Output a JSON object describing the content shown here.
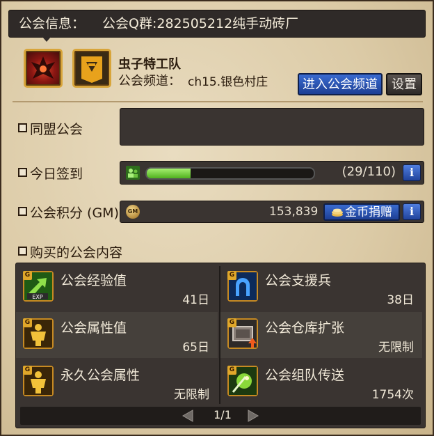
{
  "header": {
    "title": "公会信息：",
    "qq_group": "公会Q群:282505212纯手动砖厂"
  },
  "guild": {
    "name": "虫子特工队",
    "channel_label": "公会频道：",
    "channel_value": "ch15.银色村庄",
    "enter_channel_label": "进入公会频道",
    "settings_label": "设置"
  },
  "rows": {
    "alliance_label": "同盟公会",
    "checkin_label": "今日签到",
    "checkin_count": "(29/110)",
    "checkin_progress": 0.264,
    "points_label": "公会积分 (GM)",
    "points_value": "153,839",
    "donate_label": "金币捐赠",
    "info_label": "i"
  },
  "purchased": {
    "section_label": "购买的公会内容",
    "items": [
      {
        "name": "公会经验值",
        "value": "41日",
        "icon": "exp-arrow-icon"
      },
      {
        "name": "公会支援兵",
        "value": "38日",
        "icon": "support-soldier-icon"
      },
      {
        "name": "公会属性值",
        "value": "65日",
        "icon": "golden-figure-icon"
      },
      {
        "name": "公会仓库扩张",
        "value": "无限制",
        "icon": "warehouse-expand-icon"
      },
      {
        "name": "永久公会属性",
        "value": "无限制",
        "icon": "golden-figure-icon"
      },
      {
        "name": "公会组队传送",
        "value": "1754次",
        "icon": "party-teleport-icon"
      }
    ],
    "badge_letter": "G",
    "exp_badge": "EXP",
    "page": "1/1"
  },
  "colors": {
    "accent_blue": "#2a55b8",
    "progress_green": "#7ad843",
    "panel_dark": "#3a3431",
    "parchment": "#dccba7"
  }
}
